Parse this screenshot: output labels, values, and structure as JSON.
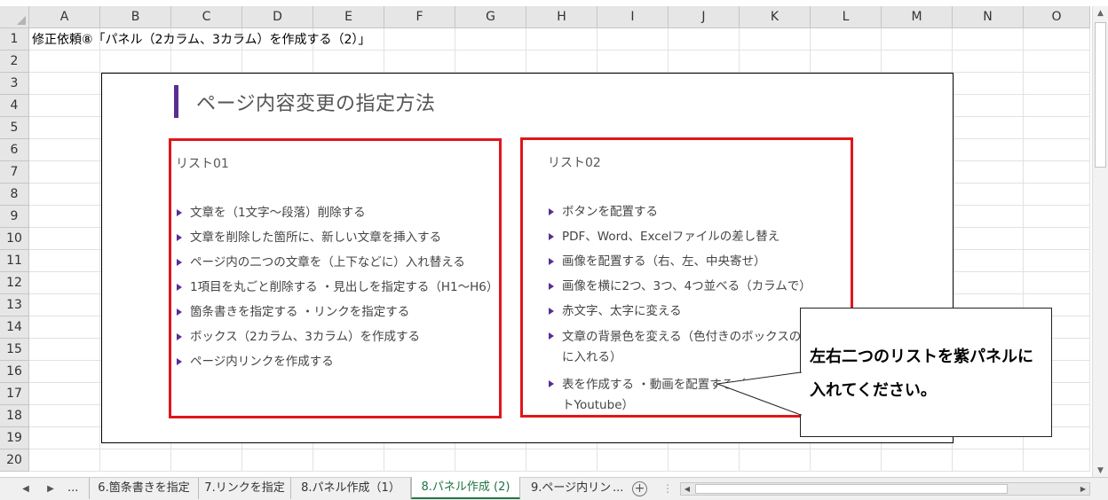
{
  "sheet": {
    "columns": [
      "A",
      "B",
      "C",
      "D",
      "E",
      "F",
      "G",
      "H",
      "I",
      "J",
      "K",
      "L",
      "M",
      "N",
      "O"
    ],
    "rows": [
      "1",
      "2",
      "3",
      "4",
      "5",
      "6",
      "7",
      "8",
      "9",
      "10",
      "11",
      "12",
      "13",
      "14",
      "15",
      "16",
      "17",
      "18",
      "19",
      "20"
    ],
    "cell_a1": "修正依頼⑧「パネル（2カラム、3カラム）を作成する（2）」"
  },
  "slide": {
    "title": "ページ内容変更の指定方法",
    "accent_color": "#5a2d91",
    "panel_border_color": "#e0161a",
    "list01": {
      "title": "リスト01",
      "items": [
        "文章を（1文字～段落）削除する",
        "文章を削除した箇所に、新しい文章を挿入する",
        "ページ内の二つの文章を（上下などに）入れ替える",
        "1項目を丸ごと削除する ・見出しを指定する（H1～H6）",
        "箇条書きを指定する ・リンクを指定する",
        "ボックス（2カラム、3カラム）を作成する",
        "ページ内リンクを作成する"
      ]
    },
    "list02": {
      "title": "リスト02",
      "items": [
        "ボタンを配置する",
        "PDF、Word、Excelファイルの差し替え",
        "画像を配置する（右、左、中央寄せ）",
        "画像を横に2つ、3つ、4つ並べる（カラムで）",
        "赤文字、太字に変える",
        "文章の背景色を変える（色付きのボックスの中に入れる）",
        "表を作成する ・動画を配置する（メディアサイトYoutube）"
      ]
    }
  },
  "callout": {
    "text": "左右二つのリストを紫パネルに入れてください。"
  },
  "tabs": {
    "ellipsis_left": "...",
    "items": [
      {
        "label": "6.箇条書きを指定"
      },
      {
        "label": "7.リンクを指定"
      },
      {
        "label": "8.パネル作成（1）"
      },
      {
        "label": "8.パネル作成 (2)",
        "active": true
      },
      {
        "label": "9.ページ内リン"
      }
    ],
    "ellipsis_right": "...",
    "add_symbol": "+",
    "active_color": "#217346"
  },
  "icons": {
    "first_sheet": "triangle-left-icon",
    "next_sheet": "triangle-right-icon",
    "add_sheet": "plus-circle-icon",
    "scroll_up": "chevron-up-icon",
    "scroll_down": "chevron-down-icon"
  }
}
